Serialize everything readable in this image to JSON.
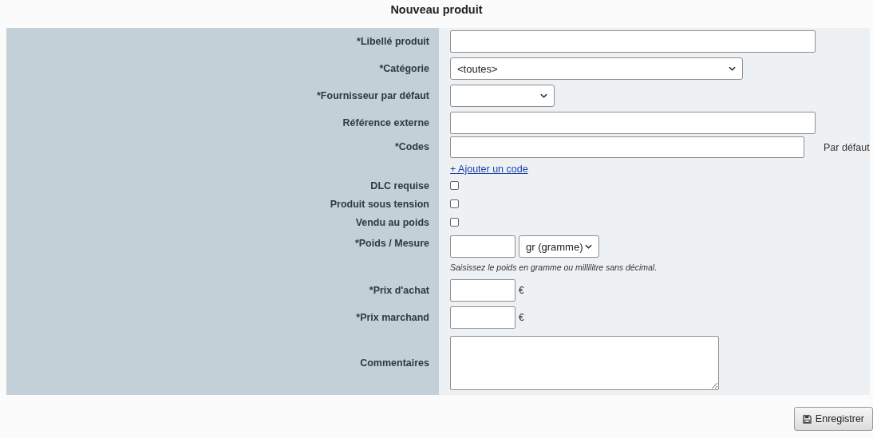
{
  "title": "Nouveau produit",
  "fields": [
    {
      "kind": "text",
      "label": "*Libellé produit"
    },
    {
      "kind": "select",
      "label": "*Catégorie",
      "value": "<toutes>"
    },
    {
      "kind": "small_select",
      "label": "*Fournisseur par défaut"
    },
    {
      "kind": "text",
      "label": "Référence externe"
    },
    {
      "kind": "codes",
      "label": "*Codes",
      "note": "Par défaut",
      "link": "+ Ajouter un code"
    },
    {
      "kind": "checkbox",
      "label": "DLC requise",
      "checked": false
    },
    {
      "kind": "checkbox",
      "label": "Produit sous tension",
      "checked": false
    },
    {
      "kind": "checkbox",
      "label": "Vendu au poids",
      "checked": false
    },
    {
      "kind": "measure",
      "label": "*Poids / Mesure",
      "unit": "gr (gramme)",
      "hint": "Saisissez le poids en gramme ou millilitre sans décimal."
    },
    {
      "kind": "price",
      "label": "*Prix d'achat",
      "currency": "€"
    },
    {
      "kind": "price",
      "label": "*Prix marchand",
      "currency": "€"
    },
    {
      "kind": "textarea",
      "label": "Commentaires"
    }
  ],
  "save_button": "Enregistrer"
}
